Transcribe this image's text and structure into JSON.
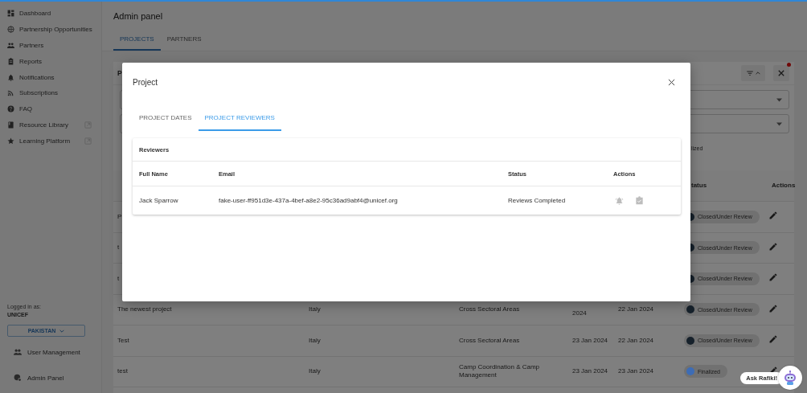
{
  "sidebar": {
    "items": [
      {
        "label": "Dashboard",
        "external": false
      },
      {
        "label": "Partnership Opportunities",
        "external": false
      },
      {
        "label": "Partners",
        "external": false
      },
      {
        "label": "Reports",
        "external": false
      },
      {
        "label": "Notifications",
        "external": false
      },
      {
        "label": "Subscriptions",
        "external": false
      },
      {
        "label": "FAQ",
        "external": false
      },
      {
        "label": "Resource Library",
        "external": true
      },
      {
        "label": "Learning Platform",
        "external": true
      }
    ],
    "logged_in_label": "Logged in as:",
    "organization": "UNICEF",
    "country_button": "PAKISTAN",
    "bottom_items": [
      {
        "label": "User Management"
      },
      {
        "label": "Admin Panel"
      }
    ]
  },
  "page": {
    "title": "Admin panel",
    "tabs": [
      {
        "label": "PROJECTS",
        "selected": true
      },
      {
        "label": "PARTNERS",
        "selected": false
      }
    ]
  },
  "projects_card": {
    "title": "P",
    "filters_active": true,
    "checkbox_label": "lized",
    "header": {
      "status": "tatus",
      "actions": "Actions"
    },
    "rows": [
      {
        "name": "P",
        "status": "Closed/Under Review",
        "color": "#16212b"
      },
      {
        "name": "t",
        "status": "Closed/Under Review",
        "color": "#16212b"
      },
      {
        "name": "t",
        "status": "Closed/Under Review",
        "color": "#16212b"
      },
      {
        "name": "The newest project",
        "country": "Italy",
        "sector": "Cross Sectoral Areas",
        "start_date": "2024",
        "end_date": "22 Jan 2024",
        "status": "Closed/Under Review",
        "color": "#16212b"
      },
      {
        "name": "Test",
        "country": "Italy",
        "sector": "Cross Sectoral Areas",
        "start_date": "23 Jan 2024",
        "end_date": "22 Jan 2024",
        "status": "Closed/Under Review",
        "color": "#16212b"
      },
      {
        "name": "test",
        "country": "Italy",
        "sector": "Camp Coordination & Camp Management",
        "start_date": "23 Jan 2024",
        "end_date": "23 Jan 2024",
        "status": "Finalized",
        "color": "#3d6cb5"
      }
    ]
  },
  "modal": {
    "title": "Project",
    "tabs": [
      {
        "label": "PROJECT DATES",
        "selected": false
      },
      {
        "label": "PROJECT REVIEWERS",
        "selected": true
      }
    ],
    "section_title": "Reviewers",
    "columns": [
      "Full Name",
      "Email",
      "Status",
      "Actions"
    ],
    "rows": [
      {
        "full_name": "Jack Sparrow",
        "email": "fake-user-ff951d3e-437a-4bef-a8e2-95c36ad9abf4@unicef.org",
        "status": "Reviews Completed",
        "actions_disabled": true
      }
    ]
  },
  "assistant": {
    "label": "Ask Rafiki!"
  }
}
